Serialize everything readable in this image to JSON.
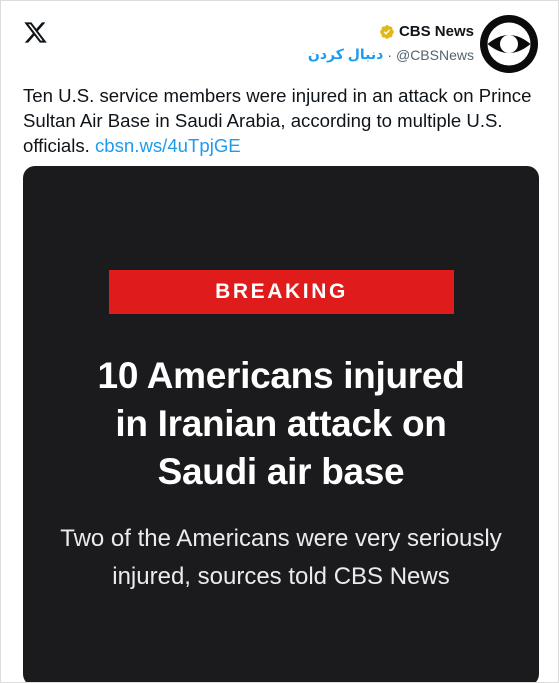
{
  "author": {
    "display_name": "CBS News",
    "handle": "@CBSNews",
    "follow_label": "دنبال کردن",
    "separator": "·",
    "verified_color": "#e2b719",
    "avatar_icon": "cbs-eye-logo-icon"
  },
  "app": {
    "logo_icon": "x-logo-icon"
  },
  "tweet": {
    "text": "Ten U.S. service members were injured in an attack on Prince Sultan Air Base in Saudi Arabia, according to multiple U.S. officials. ",
    "link": "cbsn.ws/4uTpjGE",
    "link_color": "#1d9bf0"
  },
  "media": {
    "banner_label": "BREAKING",
    "banner_color": "#e01b1b",
    "headline_lines": [
      "10 Americans injured",
      "in Iranian attack on",
      "Saudi air base"
    ],
    "subhead_lines": [
      "Two of the Americans were very seriously",
      "injured, sources told CBS News"
    ]
  }
}
